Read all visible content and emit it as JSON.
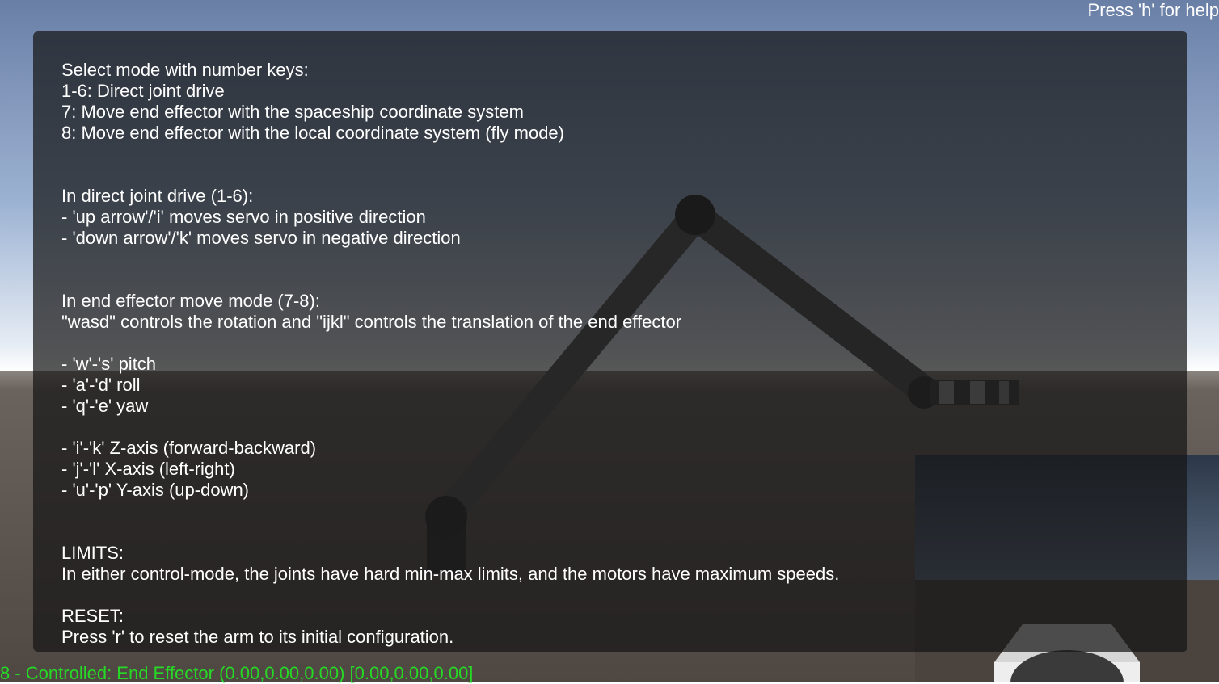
{
  "help_hint": "Press 'h' for help",
  "help": {
    "mode_title": "Select mode with number keys:",
    "mode_1_6": "1-6: Direct joint drive",
    "mode_7": "7: Move end effector with the spaceship coordinate system",
    "mode_8": "8: Move end effector with the local coordinate system (fly mode)",
    "direct_title": "In direct joint drive (1-6):",
    "direct_up": "- 'up arrow'/'i' moves servo in positive direction",
    "direct_down": "- 'down arrow'/'k' moves servo in negative direction",
    "ee_title": "In end effector move mode (7-8):",
    "ee_desc": "\"wasd\" controls the rotation and \"ijkl\" controls the translation of the end effector",
    "rot_pitch": "- 'w'-'s' pitch",
    "rot_roll": "- 'a'-'d' roll",
    "rot_yaw": "- 'q'-'e' yaw",
    "trans_z": "- 'i'-'k' Z-axis (forward-backward)",
    "trans_x": "- 'j'-'l' X-axis (left-right)",
    "trans_y": "- 'u'-'p' Y-axis (up-down)",
    "limits_title": "LIMITS:",
    "limits_desc": "In either control-mode, the joints have hard min-max limits, and the motors have maximum speeds.",
    "reset_title": "RESET:",
    "reset_desc": "Press 'r' to reset the arm to its initial configuration."
  },
  "status": "8 - Controlled: End Effector (0.00,0.00,0.00) [0.00,0.00,0.00]",
  "colors": {
    "sky_top": "#6a7fa6",
    "sky_horizon": "#ffffff",
    "ground": "#5b524c",
    "arm": "#4a4a4a",
    "status_text": "#26d926",
    "panel_bg": "rgba(22,22,22,0.72)"
  }
}
